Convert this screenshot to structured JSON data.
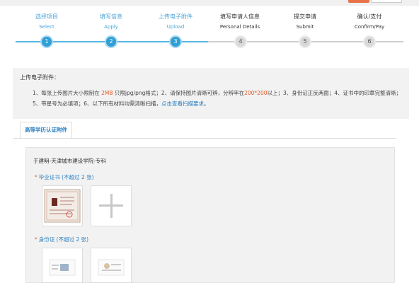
{
  "steps": [
    {
      "title": "选择项目",
      "sub": "Select",
      "num": "1",
      "state": "done"
    },
    {
      "title": "填写信息",
      "sub": "Apply",
      "num": "2",
      "state": "done"
    },
    {
      "title": "上传电子附件",
      "sub": "Upload",
      "num": "3",
      "state": "done"
    },
    {
      "title": "填写申请人信息",
      "sub": "Personal Details",
      "num": "4",
      "state": "todo"
    },
    {
      "title": "提交申请",
      "sub": "Submit",
      "num": "5",
      "state": "todo"
    },
    {
      "title": "确认/支付",
      "sub": "Confirm/Pay",
      "num": "6",
      "state": "todo"
    }
  ],
  "notice": {
    "title": "上传电子附件：",
    "p1": "1、每张上传图片大小限制在 ",
    "size_limit": "2MB",
    "p2": " 只限jpg/png格式；2、请保持图片清晰可辨，分辨率在",
    "resolution": "200*200",
    "p3": "以上；3、身份证正反两面；4、证书中的印章完整清晰；5、带星号为必填项；6、以下所有材料均需清晰扫描，",
    "link_text": "点击查看扫描要求",
    "end": "。"
  },
  "tab": {
    "label": "高等学历认证附件"
  },
  "panel": {
    "person": "于建明-天津城市建设学院-专科",
    "group1_star": "*",
    "group1_label": "毕业证书 (不超过 2 张)",
    "group2_star": "*",
    "group2_label": "身份证 (不超过 2 张)"
  },
  "colors": {
    "accent": "#2f9fd6",
    "step_done_text": "#4aa3d6",
    "highlight_red": "#e55b2a",
    "link": "#2a7fc1"
  }
}
